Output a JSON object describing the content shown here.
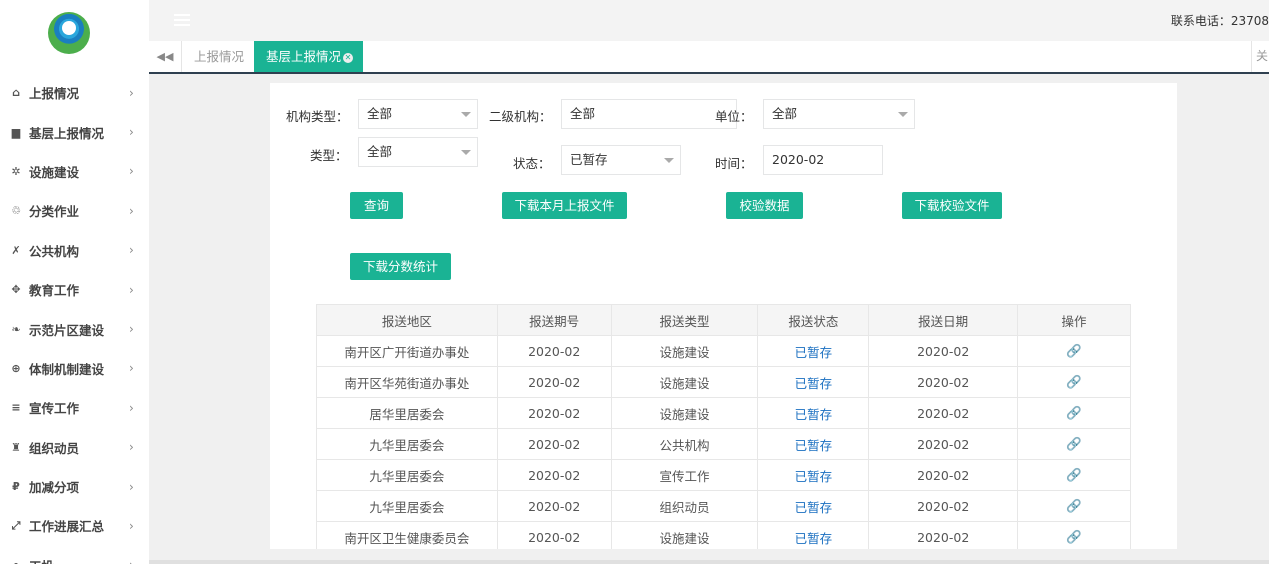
{
  "sidebar": {
    "items": [
      {
        "icon": "home-icon",
        "glyph": "⌂",
        "label": "上报情况"
      },
      {
        "icon": "file-icon",
        "glyph": "▆",
        "label": "基层上报情况"
      },
      {
        "icon": "gear-icon",
        "glyph": "✲",
        "label": "设施建设"
      },
      {
        "icon": "recycle-icon",
        "glyph": "♲",
        "label": "分类作业"
      },
      {
        "icon": "building-icon",
        "glyph": "✗",
        "label": "公共机构"
      },
      {
        "icon": "arrows-icon",
        "glyph": "✥",
        "label": "教育工作"
      },
      {
        "icon": "leaf-icon",
        "glyph": "❧",
        "label": "示范片区建设"
      },
      {
        "icon": "lifebuoy-icon",
        "glyph": "⊕",
        "label": "体制机制建设"
      },
      {
        "icon": "list-icon",
        "glyph": "≡",
        "label": "宣传工作"
      },
      {
        "icon": "users-icon",
        "glyph": "♜",
        "label": "组织动员"
      },
      {
        "icon": "currency-icon",
        "glyph": "₽",
        "label": "加减分项"
      },
      {
        "icon": "expand-icon",
        "glyph": "⤢",
        "label": "工作进展汇总"
      },
      {
        "icon": "more-icon",
        "glyph": "•",
        "label": "工投"
      }
    ],
    "arrow": "›"
  },
  "header": {
    "contact": "联系电话：23708"
  },
  "tabs": {
    "back_glyph": "◀◀",
    "items": [
      {
        "label": "上报情况"
      },
      {
        "label": "基层上报情况",
        "close": "✕"
      }
    ],
    "right_label": "关"
  },
  "filters": {
    "org_type_label": "机构类型：",
    "org_type_value": "全部",
    "sub_org_label": "二级机构：",
    "sub_org_value": "全部",
    "unit_label": "单位：",
    "unit_value": "全部",
    "type_label": "类型：",
    "type_value": "全部",
    "status_label": "状态：",
    "status_value": "已暂存",
    "time_label": "时间：",
    "time_value": "2020-02"
  },
  "buttons": {
    "query": "查询",
    "download_monthly": "下载本月上报文件",
    "validate": "校验数据",
    "download_validation": "下载校验文件",
    "download_scores": "下载分数统计"
  },
  "table": {
    "headers": [
      "报送地区",
      "报送期号",
      "报送类型",
      "报送状态",
      "报送日期",
      "操作"
    ],
    "rows": [
      [
        "南开区广开街道办事处",
        "2020-02",
        "设施建设",
        "已暂存",
        "2020-02"
      ],
      [
        "南开区华苑街道办事处",
        "2020-02",
        "设施建设",
        "已暂存",
        "2020-02"
      ],
      [
        "居华里居委会",
        "2020-02",
        "设施建设",
        "已暂存",
        "2020-02"
      ],
      [
        "九华里居委会",
        "2020-02",
        "公共机构",
        "已暂存",
        "2020-02"
      ],
      [
        "九华里居委会",
        "2020-02",
        "宣传工作",
        "已暂存",
        "2020-02"
      ],
      [
        "九华里居委会",
        "2020-02",
        "组织动员",
        "已暂存",
        "2020-02"
      ],
      [
        "南开区卫生健康委员会",
        "2020-02",
        "设施建设",
        "已暂存",
        "2020-02"
      ]
    ],
    "op_icon": "link-icon",
    "op_glyph": "🔗"
  },
  "colors": {
    "accent": "#1ab394",
    "status_link": "#1a6fc0",
    "nav_dark": "#2f4050"
  }
}
